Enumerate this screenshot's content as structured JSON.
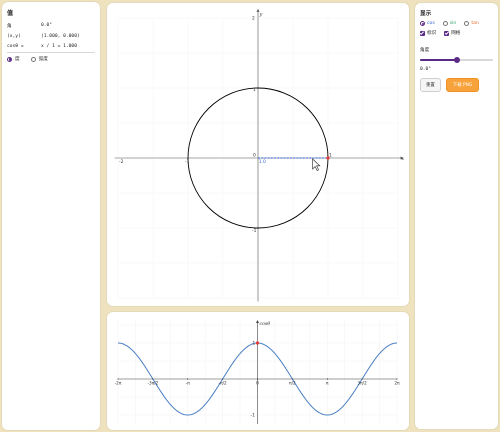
{
  "info": {
    "title": "值",
    "angle_label": "角",
    "angle_value": "0.0°",
    "xy_label": "(x,y)",
    "xy_value": "(1.000, 0.000)",
    "cos_label": "cosθ =",
    "cos_value": "x / 1 = 1.000",
    "unit_degree": "度",
    "unit_radian": "弧度",
    "unit_selected": "degree"
  },
  "circle": {
    "axis_x_name": "x",
    "axis_y_name": "y",
    "tick_neg2": "-2",
    "tick_2": "2",
    "tick_x_neg1": "-1",
    "tick_x_1": "1",
    "tick_y_1": "1",
    "tick_y_neg1": "-1",
    "origin": "0",
    "point_label": "1.0",
    "angle_deg": 0,
    "x_range": [
      -2,
      2
    ],
    "y_range": [
      -2,
      2
    ],
    "circle_color": "#000000",
    "projection_color": "#2f5fd0",
    "point_color": "#e53935"
  },
  "wave": {
    "label": "cosθ",
    "tick_labels": [
      "-2π",
      "-3π/2",
      "-π",
      "-π/2",
      "0",
      "π/2",
      "π",
      "3π/2",
      "2π"
    ],
    "y_tick_1": "1",
    "y_tick_neg1": "-1",
    "x_range_pi": [
      -2,
      2
    ],
    "y_range": [
      -1,
      1
    ],
    "curve_color": "#4a7fc4",
    "point_color": "#e53935"
  },
  "controls": {
    "title": "显示",
    "func_cos": "cos",
    "func_sin": "sin",
    "func_tan": "tan",
    "func_selected": "cos",
    "cos_color": "#2f5fd0",
    "sin_color": "#2a9d6a",
    "tan_color": "#e86b2f",
    "check_labels": "标识",
    "check_grid": "网格",
    "angle_title": "角度",
    "angle_value": "0.0°",
    "slider_value_deg": 0,
    "slider_min_deg": -180,
    "slider_max_deg": 180,
    "reset_label": "重置",
    "download_label": "下载 PNG",
    "accent_color": "#5b2a86",
    "download_color": "#f7a23b"
  }
}
